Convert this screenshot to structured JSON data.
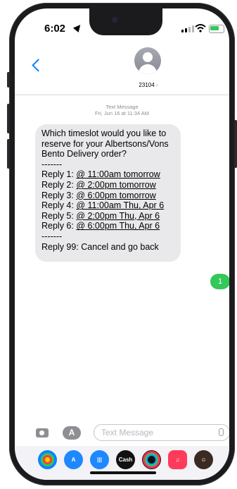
{
  "status_bar": {
    "time": "6:02"
  },
  "header": {
    "contact_name": "23104",
    "chevron": "›"
  },
  "thread": {
    "service_label": "Text Message",
    "timestamp": "Fri, Jun 16 at 11:34 AM",
    "incoming": {
      "intro": "Which timeslot would you like to reserve for your Albertsons/Vons Bento Delivery order?",
      "separator_top": "-------",
      "options": [
        {
          "prefix": "Reply 1: ",
          "slot": "@ 11:00am tomorrow"
        },
        {
          "prefix": "Reply 2: ",
          "slot": "@ 2:00pm tomorrow"
        },
        {
          "prefix": "Reply 3: ",
          "slot": "@ 6:00pm tomorrow"
        },
        {
          "prefix": "Reply 4: ",
          "slot": "@ 11:00am Thu, Apr 6"
        },
        {
          "prefix": "Reply 5: ",
          "slot": "@ 2:00pm Thu, Apr 6"
        },
        {
          "prefix": "Reply 6: ",
          "slot": "@ 6:00pm Thu, Apr 6"
        }
      ],
      "separator_bottom": "-------",
      "cancel_line": "Reply 99: Cancel and go back"
    },
    "outgoing": {
      "text": "1"
    }
  },
  "compose": {
    "placeholder": "Text Message",
    "apps_glyph": "A"
  },
  "dock": {
    "apps": [
      {
        "icon": "photos-icon",
        "label": "",
        "color": "#ffffff"
      },
      {
        "icon": "app-store-icon",
        "label": "",
        "color": "#1e88ff"
      },
      {
        "icon": "audio-messages-icon",
        "label": "",
        "color": "#1e88ff"
      },
      {
        "icon": "apple-cash-icon",
        "label": "Cash",
        "color": "#111111"
      },
      {
        "icon": "fitness-icon",
        "label": "",
        "color": "#111111"
      },
      {
        "icon": "music-icon",
        "label": "",
        "color": "#ff3b5c"
      },
      {
        "icon": "memoji-icon",
        "label": "",
        "color": "#3a2a22"
      }
    ]
  },
  "colors": {
    "accent": "#0a84ff",
    "sent_bubble": "#34c759",
    "received_bubble": "#e9e9eb"
  }
}
